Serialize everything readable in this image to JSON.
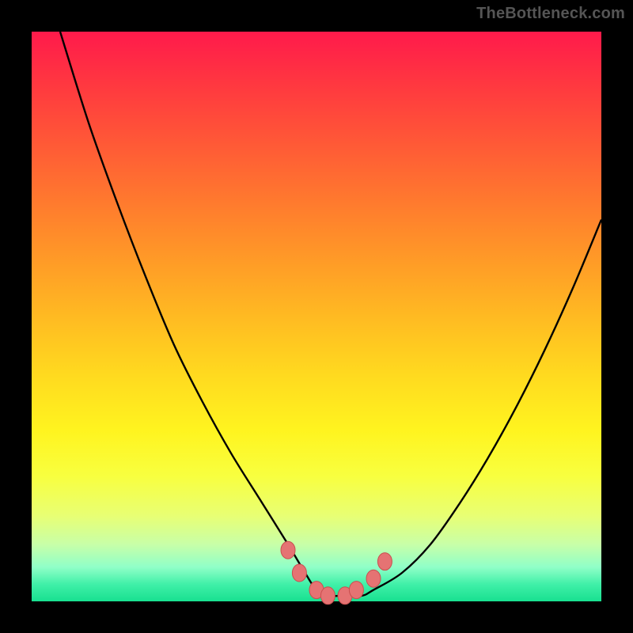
{
  "watermark": "TheBottleneck.com",
  "colors": {
    "page_bg": "#000000",
    "watermark": "#555555",
    "curve": "#000000",
    "marker_fill": "#e57373",
    "marker_stroke": "#c94f4f",
    "gradient_stops": [
      "#ff1a4b",
      "#ff3a3f",
      "#ff5a36",
      "#ff7a2e",
      "#ff9a27",
      "#ffba22",
      "#ffd91f",
      "#fff41f",
      "#f8ff3f",
      "#e8ff74",
      "#c8ffa8",
      "#90ffc8",
      "#40f0a8",
      "#18e090"
    ]
  },
  "chart_data": {
    "type": "line",
    "title": "",
    "xlabel": "",
    "ylabel": "",
    "xlim": [
      0,
      100
    ],
    "ylim": [
      0,
      100
    ],
    "grid": false,
    "legend": false,
    "series": [
      {
        "name": "bottleneck-curve",
        "x": [
          5,
          10,
          15,
          20,
          25,
          30,
          35,
          40,
          45,
          48,
          50,
          52,
          55,
          58,
          60,
          65,
          70,
          75,
          80,
          85,
          90,
          95,
          100
        ],
        "y": [
          100,
          84,
          70,
          57,
          45,
          35,
          26,
          18,
          10,
          5,
          2,
          1,
          1,
          1,
          2,
          5,
          10,
          17,
          25,
          34,
          44,
          55,
          67
        ]
      }
    ],
    "markers": {
      "name": "highlight-dots",
      "x": [
        45,
        47,
        50,
        52,
        55,
        57,
        60,
        62
      ],
      "y": [
        9,
        5,
        2,
        1,
        1,
        2,
        4,
        7
      ]
    },
    "annotations": []
  }
}
